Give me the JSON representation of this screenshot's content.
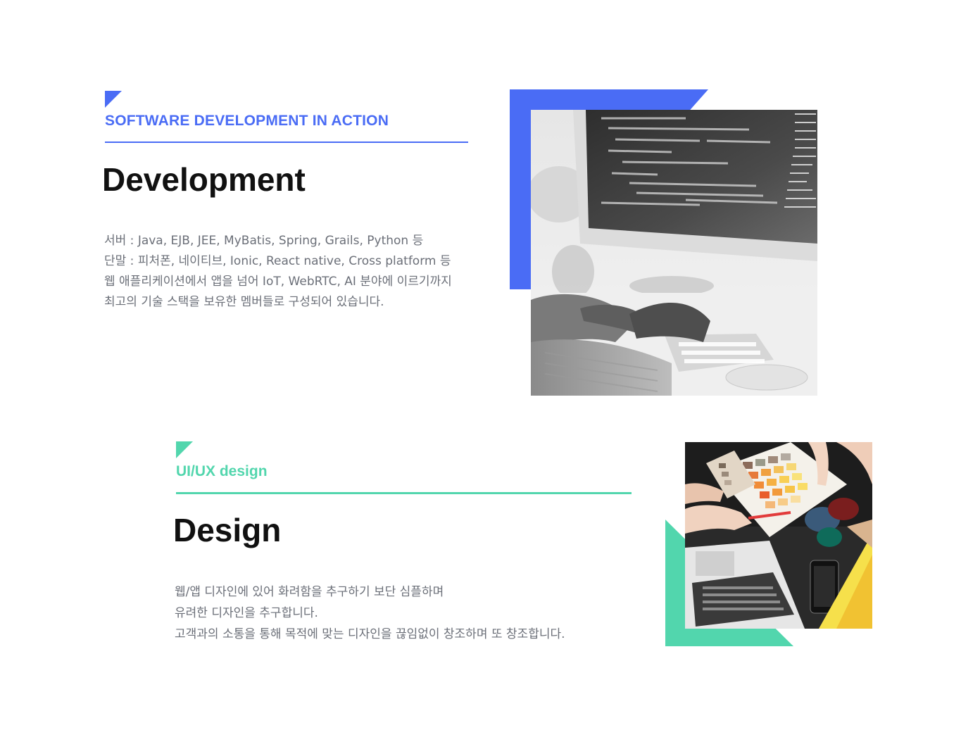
{
  "development": {
    "kicker": "SOFTWARE DEVELOPMENT IN ACTION",
    "title": "Development",
    "lines": [
      "서버 : Java, EJB, JEE, MyBatis, Spring, Grails, Python 등",
      "단말 : 피처폰, 네이티브, Ionic, React native, Cross platform 등",
      "웹 애플리케이션에서 앱을 넘어 IoT, WebRTC, AI 분야에 이르기까지",
      "최고의 기술 스택을 보유한 멤버들로 구성되어 있습니다."
    ],
    "accent_color": "#4a6cf5",
    "photo_icon": "developer-computer-photo"
  },
  "design": {
    "kicker": "UI/UX design",
    "title": "Design",
    "lines": [
      "웹/앱 디자인에 있어 화려함을 추구하기 보단 심플하며",
      "유려한 디자인을 추구합니다.",
      "고객과의 소통을 통해 목적에 맞는 디자인을 끊임없이 창조하며 또 창조합니다."
    ],
    "accent_color": "#52d6ad",
    "photo_icon": "color-swatch-photo"
  }
}
